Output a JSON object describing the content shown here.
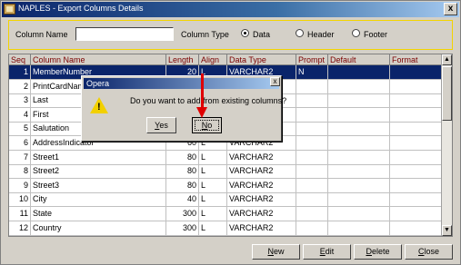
{
  "window": {
    "title": "NAPLES - Export Columns Details",
    "close_label": "x"
  },
  "filter": {
    "column_name_label": "Column Name",
    "column_name_value": "",
    "column_type_label": "Column Type",
    "options": [
      {
        "label": "Data",
        "selected": true
      },
      {
        "label": "Header",
        "selected": false
      },
      {
        "label": "Footer",
        "selected": false
      }
    ]
  },
  "grid": {
    "headers": [
      "Seq",
      "Column Name",
      "Length",
      "Align",
      "Data Type",
      "Prompt",
      "Default",
      "Format"
    ],
    "rows": [
      {
        "seq": "1",
        "name": "MemberNumber",
        "length": "20",
        "align": "L",
        "type": "VARCHAR2",
        "prompt": "N",
        "default": "",
        "format": ""
      },
      {
        "seq": "2",
        "name": "PrintCardNam",
        "length": "",
        "align": "",
        "type": "",
        "prompt": "",
        "default": "",
        "format": ""
      },
      {
        "seq": "3",
        "name": "Last",
        "length": "",
        "align": "",
        "type": "",
        "prompt": "",
        "default": "",
        "format": ""
      },
      {
        "seq": "4",
        "name": "First",
        "length": "",
        "align": "",
        "type": "",
        "prompt": "",
        "default": "",
        "format": ""
      },
      {
        "seq": "5",
        "name": "Salutation",
        "length": "",
        "align": "",
        "type": "",
        "prompt": "",
        "default": "",
        "format": ""
      },
      {
        "seq": "6",
        "name": "AddressIndicator",
        "length": "60",
        "align": "L",
        "type": "VARCHAR2",
        "prompt": "",
        "default": "",
        "format": ""
      },
      {
        "seq": "7",
        "name": "Street1",
        "length": "80",
        "align": "L",
        "type": "VARCHAR2",
        "prompt": "",
        "default": "",
        "format": ""
      },
      {
        "seq": "8",
        "name": "Street2",
        "length": "80",
        "align": "L",
        "type": "VARCHAR2",
        "prompt": "",
        "default": "",
        "format": ""
      },
      {
        "seq": "9",
        "name": "Street3",
        "length": "80",
        "align": "L",
        "type": "VARCHAR2",
        "prompt": "",
        "default": "",
        "format": ""
      },
      {
        "seq": "10",
        "name": "City",
        "length": "40",
        "align": "L",
        "type": "VARCHAR2",
        "prompt": "",
        "default": "",
        "format": ""
      },
      {
        "seq": "11",
        "name": "State",
        "length": "300",
        "align": "L",
        "type": "VARCHAR2",
        "prompt": "",
        "default": "",
        "format": ""
      },
      {
        "seq": "12",
        "name": "Country",
        "length": "300",
        "align": "L",
        "type": "VARCHAR2",
        "prompt": "",
        "default": "",
        "format": ""
      }
    ]
  },
  "buttons": {
    "new": "New",
    "edit": "Edit",
    "delete": "Delete",
    "close": "Close"
  },
  "dialog": {
    "title": "Opera",
    "close_label": "x",
    "message": "Do you want to add from existing columns?",
    "icon": "warning-icon",
    "yes": "Yes",
    "no": "No"
  },
  "colors": {
    "selection": "#0a246a",
    "header_text": "#7a0000",
    "annotation_arrow": "#e00000",
    "filter_border": "#f3d400"
  }
}
